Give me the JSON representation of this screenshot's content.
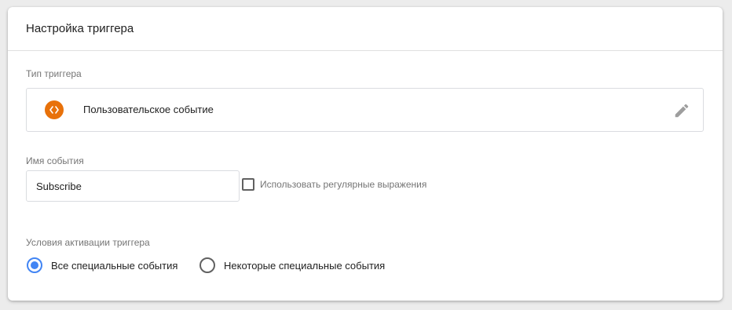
{
  "card": {
    "title": "Настройка триггера"
  },
  "trigger_type": {
    "label": "Тип триггера",
    "name": "Пользовательское событие",
    "icon": "custom-event-icon",
    "icon_color": "#e8710a"
  },
  "event_name": {
    "label": "Имя события",
    "value": "Subscribe",
    "regex_checkbox_label": "Использовать регулярные выражения",
    "regex_checked": false
  },
  "activation": {
    "label": "Условия активации триггера",
    "options": [
      {
        "label": "Все специальные события",
        "selected": true
      },
      {
        "label": "Некоторые специальные события",
        "selected": false
      }
    ],
    "accent_color": "#4285f4"
  }
}
